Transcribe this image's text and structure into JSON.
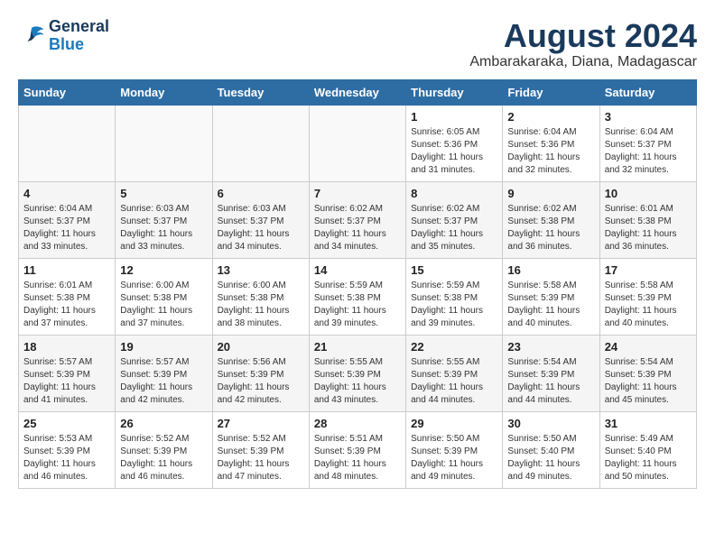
{
  "logo": {
    "line1": "General",
    "line2": "Blue"
  },
  "title": "August 2024",
  "location": "Ambarakaraka, Diana, Madagascar",
  "days": [
    "Sunday",
    "Monday",
    "Tuesday",
    "Wednesday",
    "Thursday",
    "Friday",
    "Saturday"
  ],
  "weeks": [
    [
      {
        "date": "",
        "info": ""
      },
      {
        "date": "",
        "info": ""
      },
      {
        "date": "",
        "info": ""
      },
      {
        "date": "",
        "info": ""
      },
      {
        "date": "1",
        "info": "Sunrise: 6:05 AM\nSunset: 5:36 PM\nDaylight: 11 hours\nand 31 minutes."
      },
      {
        "date": "2",
        "info": "Sunrise: 6:04 AM\nSunset: 5:36 PM\nDaylight: 11 hours\nand 32 minutes."
      },
      {
        "date": "3",
        "info": "Sunrise: 6:04 AM\nSunset: 5:37 PM\nDaylight: 11 hours\nand 32 minutes."
      }
    ],
    [
      {
        "date": "4",
        "info": "Sunrise: 6:04 AM\nSunset: 5:37 PM\nDaylight: 11 hours\nand 33 minutes."
      },
      {
        "date": "5",
        "info": "Sunrise: 6:03 AM\nSunset: 5:37 PM\nDaylight: 11 hours\nand 33 minutes."
      },
      {
        "date": "6",
        "info": "Sunrise: 6:03 AM\nSunset: 5:37 PM\nDaylight: 11 hours\nand 34 minutes."
      },
      {
        "date": "7",
        "info": "Sunrise: 6:02 AM\nSunset: 5:37 PM\nDaylight: 11 hours\nand 34 minutes."
      },
      {
        "date": "8",
        "info": "Sunrise: 6:02 AM\nSunset: 5:37 PM\nDaylight: 11 hours\nand 35 minutes."
      },
      {
        "date": "9",
        "info": "Sunrise: 6:02 AM\nSunset: 5:38 PM\nDaylight: 11 hours\nand 36 minutes."
      },
      {
        "date": "10",
        "info": "Sunrise: 6:01 AM\nSunset: 5:38 PM\nDaylight: 11 hours\nand 36 minutes."
      }
    ],
    [
      {
        "date": "11",
        "info": "Sunrise: 6:01 AM\nSunset: 5:38 PM\nDaylight: 11 hours\nand 37 minutes."
      },
      {
        "date": "12",
        "info": "Sunrise: 6:00 AM\nSunset: 5:38 PM\nDaylight: 11 hours\nand 37 minutes."
      },
      {
        "date": "13",
        "info": "Sunrise: 6:00 AM\nSunset: 5:38 PM\nDaylight: 11 hours\nand 38 minutes."
      },
      {
        "date": "14",
        "info": "Sunrise: 5:59 AM\nSunset: 5:38 PM\nDaylight: 11 hours\nand 39 minutes."
      },
      {
        "date": "15",
        "info": "Sunrise: 5:59 AM\nSunset: 5:38 PM\nDaylight: 11 hours\nand 39 minutes."
      },
      {
        "date": "16",
        "info": "Sunrise: 5:58 AM\nSunset: 5:39 PM\nDaylight: 11 hours\nand 40 minutes."
      },
      {
        "date": "17",
        "info": "Sunrise: 5:58 AM\nSunset: 5:39 PM\nDaylight: 11 hours\nand 40 minutes."
      }
    ],
    [
      {
        "date": "18",
        "info": "Sunrise: 5:57 AM\nSunset: 5:39 PM\nDaylight: 11 hours\nand 41 minutes."
      },
      {
        "date": "19",
        "info": "Sunrise: 5:57 AM\nSunset: 5:39 PM\nDaylight: 11 hours\nand 42 minutes."
      },
      {
        "date": "20",
        "info": "Sunrise: 5:56 AM\nSunset: 5:39 PM\nDaylight: 11 hours\nand 42 minutes."
      },
      {
        "date": "21",
        "info": "Sunrise: 5:55 AM\nSunset: 5:39 PM\nDaylight: 11 hours\nand 43 minutes."
      },
      {
        "date": "22",
        "info": "Sunrise: 5:55 AM\nSunset: 5:39 PM\nDaylight: 11 hours\nand 44 minutes."
      },
      {
        "date": "23",
        "info": "Sunrise: 5:54 AM\nSunset: 5:39 PM\nDaylight: 11 hours\nand 44 minutes."
      },
      {
        "date": "24",
        "info": "Sunrise: 5:54 AM\nSunset: 5:39 PM\nDaylight: 11 hours\nand 45 minutes."
      }
    ],
    [
      {
        "date": "25",
        "info": "Sunrise: 5:53 AM\nSunset: 5:39 PM\nDaylight: 11 hours\nand 46 minutes."
      },
      {
        "date": "26",
        "info": "Sunrise: 5:52 AM\nSunset: 5:39 PM\nDaylight: 11 hours\nand 46 minutes."
      },
      {
        "date": "27",
        "info": "Sunrise: 5:52 AM\nSunset: 5:39 PM\nDaylight: 11 hours\nand 47 minutes."
      },
      {
        "date": "28",
        "info": "Sunrise: 5:51 AM\nSunset: 5:39 PM\nDaylight: 11 hours\nand 48 minutes."
      },
      {
        "date": "29",
        "info": "Sunrise: 5:50 AM\nSunset: 5:39 PM\nDaylight: 11 hours\nand 49 minutes."
      },
      {
        "date": "30",
        "info": "Sunrise: 5:50 AM\nSunset: 5:40 PM\nDaylight: 11 hours\nand 49 minutes."
      },
      {
        "date": "31",
        "info": "Sunrise: 5:49 AM\nSunset: 5:40 PM\nDaylight: 11 hours\nand 50 minutes."
      }
    ]
  ]
}
